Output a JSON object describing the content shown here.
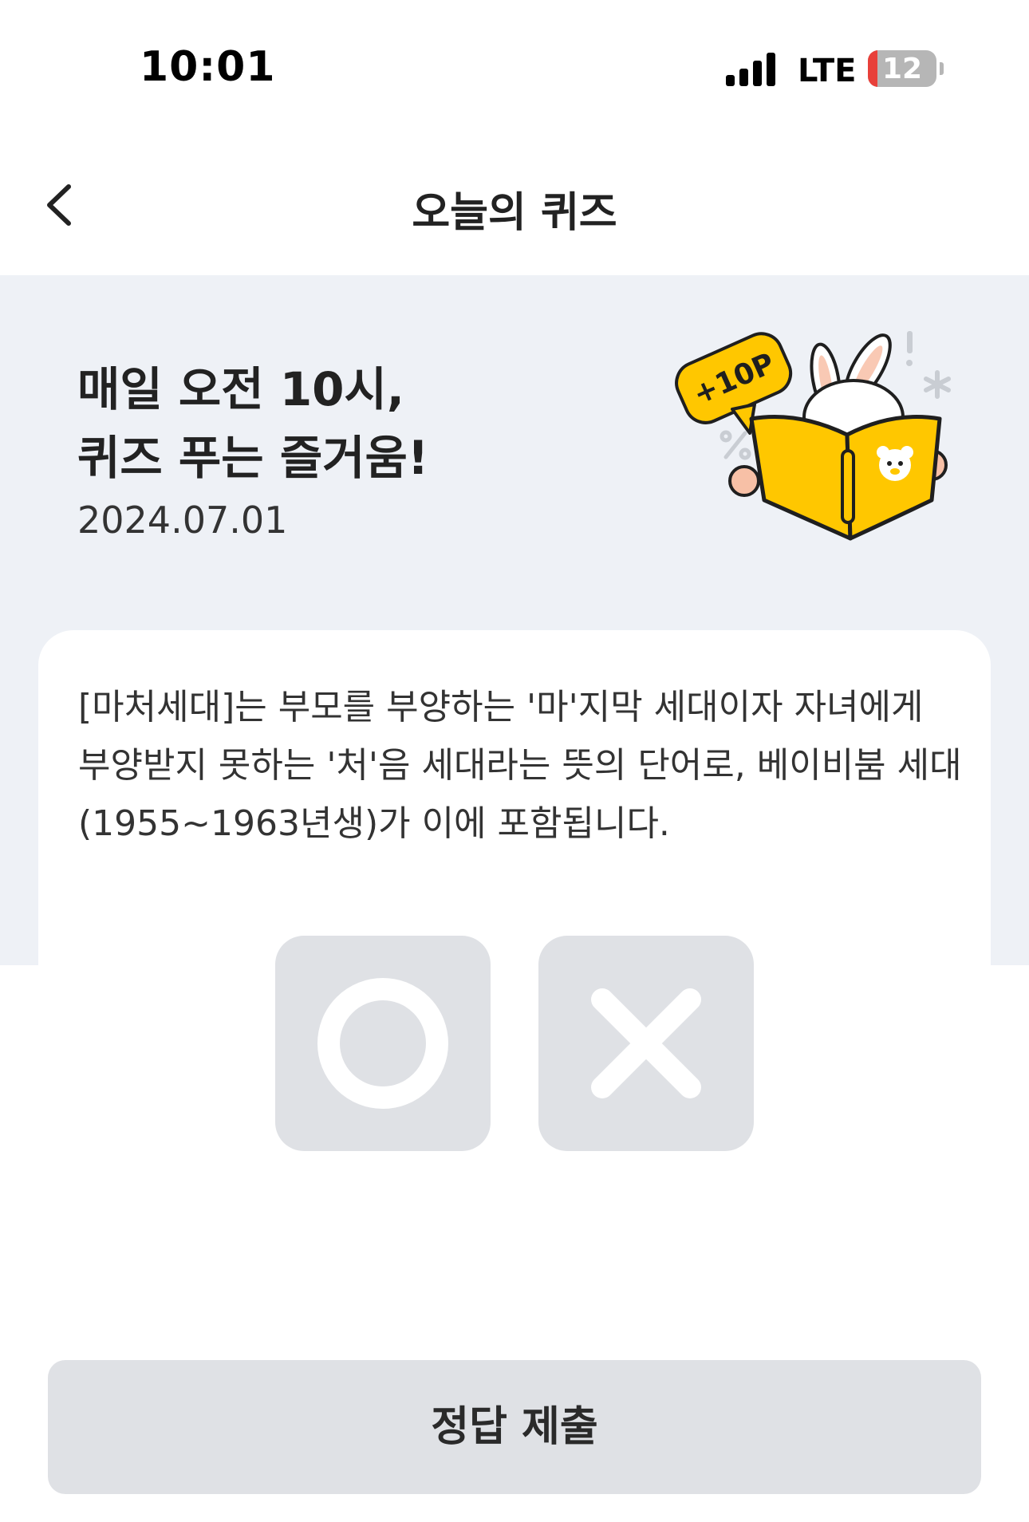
{
  "status_bar": {
    "time": "10:01",
    "network": "LTE",
    "battery_level": "12",
    "battery_color": "#e8403a"
  },
  "nav": {
    "title": "오늘의 퀴즈",
    "back_icon": "chevron-left-icon"
  },
  "hero": {
    "title": "매일 오전 10시,\n퀴즈 푸는 즐거움!",
    "date": "2024.07.01",
    "badge": "+10P",
    "background": "#eef1f6"
  },
  "quiz": {
    "question": "[마처세대]는 부모를 부양하는 '마'지막 세대이자 자녀에게 부양받지 못하는 '처'음 세대라는 뜻의 단어로, 베이비붐 세대(1955~1963년생)가 이에 포함됩니다.",
    "options": [
      {
        "icon": "circle-o-icon"
      },
      {
        "icon": "x-mark-icon"
      }
    ]
  },
  "submit": {
    "label": "정답 제출"
  },
  "colors": {
    "accent_yellow": "#ffc700",
    "button_gray": "#dfe1e5"
  }
}
